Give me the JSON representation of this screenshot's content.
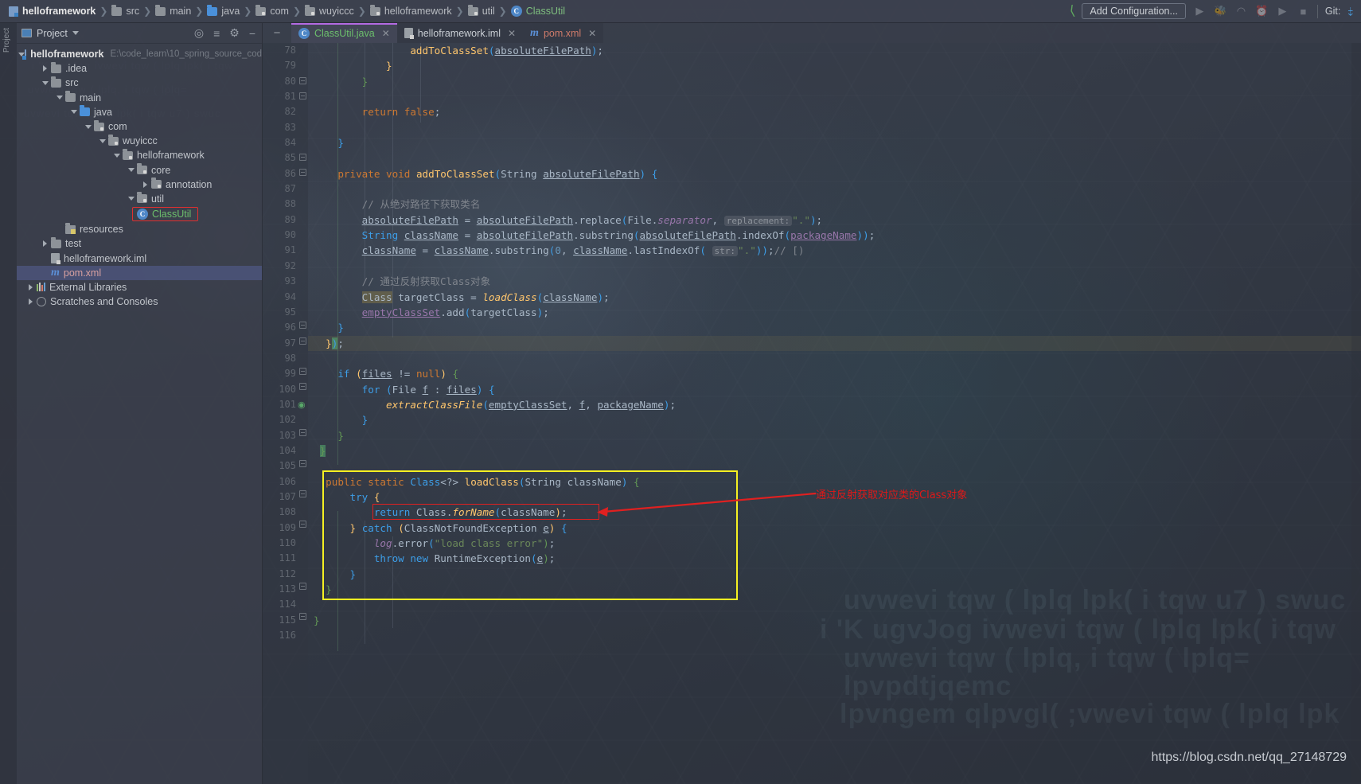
{
  "window": {
    "breadcrumb": [
      {
        "label": "helloframework",
        "icon": "module-icon"
      },
      {
        "label": "src",
        "icon": "folder-icon"
      },
      {
        "label": "main",
        "icon": "folder-icon"
      },
      {
        "label": "java",
        "icon": "source-folder-icon"
      },
      {
        "label": "com",
        "icon": "package-icon"
      },
      {
        "label": "wuyiccc",
        "icon": "package-icon"
      },
      {
        "label": "helloframework",
        "icon": "package-icon"
      },
      {
        "label": "util",
        "icon": "package-icon"
      },
      {
        "label": "ClassUtil",
        "icon": "class-icon"
      }
    ],
    "toolbar": {
      "add_configuration_label": "Add Configuration...",
      "git_label": "Git:",
      "icons": [
        "run-icon",
        "debug-icon",
        "run-with-coverage-icon",
        "profiler-icon",
        "run-alt-icon",
        "stop-icon"
      ]
    }
  },
  "left_rail": {
    "label": "Project"
  },
  "project_panel": {
    "title": "Project",
    "header_icons": [
      "locate-icon",
      "collapse-all-icon",
      "settings-gear-icon",
      "hide-icon"
    ],
    "tree": [
      {
        "depth": 0,
        "label": "helloframework",
        "path": "E:\\code_learn\\10_spring_source_cod",
        "icon": "module-icon",
        "arrow": "open",
        "bold": true
      },
      {
        "depth": 1,
        "label": ".idea",
        "icon": "folder-icon",
        "arrow": "closed"
      },
      {
        "depth": 1,
        "label": "src",
        "icon": "folder-icon",
        "arrow": "open"
      },
      {
        "depth": 2,
        "label": "main",
        "icon": "folder-icon",
        "arrow": "open"
      },
      {
        "depth": 3,
        "label": "java",
        "icon": "source-folder-icon",
        "arrow": "open"
      },
      {
        "depth": 4,
        "label": "com",
        "icon": "package-icon",
        "arrow": "open"
      },
      {
        "depth": 5,
        "label": "wuyiccc",
        "icon": "package-icon",
        "arrow": "open"
      },
      {
        "depth": 6,
        "label": "helloframework",
        "icon": "package-icon",
        "arrow": "open"
      },
      {
        "depth": 7,
        "label": "core",
        "icon": "package-icon",
        "arrow": "open"
      },
      {
        "depth": 8,
        "label": "annotation",
        "icon": "package-icon",
        "arrow": "closed"
      },
      {
        "depth": 8,
        "label": "util",
        "icon": "package-icon",
        "arrow": "open"
      },
      {
        "depth": 9,
        "label": "ClassUtil",
        "icon": "class-icon",
        "arrow": "none",
        "highlighted": true,
        "green": true
      },
      {
        "depth": 3,
        "label": "resources",
        "icon": "resources-folder-icon",
        "arrow": "none"
      },
      {
        "depth": 2,
        "label": "test",
        "icon": "folder-icon",
        "arrow": "closed"
      },
      {
        "depth": 1,
        "label": "helloframework.iml",
        "icon": "iml-file-icon",
        "arrow": "none"
      },
      {
        "depth": 1,
        "label": "pom.xml",
        "icon": "maven-icon",
        "arrow": "none",
        "selected": true
      },
      {
        "depth": 0,
        "label": "External Libraries",
        "icon": "libraries-icon",
        "arrow": "closed"
      },
      {
        "depth": 0,
        "label": "Scratches and Consoles",
        "icon": "scratches-icon",
        "arrow": "closed"
      }
    ]
  },
  "editor": {
    "tabs": [
      {
        "label": "ClassUtil.java",
        "icon": "class-icon",
        "active": true,
        "closable": true
      },
      {
        "label": "helloframework.iml",
        "icon": "iml-file-icon",
        "active": false,
        "closable": true
      },
      {
        "label": "pom.xml",
        "icon": "maven-icon",
        "active": false,
        "closable": true
      }
    ],
    "first_line_number": 78,
    "highlighted_line": 97,
    "lines": [
      {
        "n": 78,
        "text": "                addToClassSet(absoluteFilePath);"
      },
      {
        "n": 79,
        "text": "            }"
      },
      {
        "n": 80,
        "text": "        }"
      },
      {
        "n": 81,
        "text": ""
      },
      {
        "n": 82,
        "text": "        return false;"
      },
      {
        "n": 83,
        "text": ""
      },
      {
        "n": 84,
        "text": "    }"
      },
      {
        "n": 85,
        "text": ""
      },
      {
        "n": 86,
        "text": "    private void addToClassSet(String absoluteFilePath) {"
      },
      {
        "n": 87,
        "text": ""
      },
      {
        "n": 88,
        "text": "        // 从绝对路径下获取类名"
      },
      {
        "n": 89,
        "text": "        absoluteFilePath = absoluteFilePath.replace(File.separator,  replacement: \".\");"
      },
      {
        "n": 90,
        "text": "        String className = absoluteFilePath.substring(absoluteFilePath.indexOf(packageName));"
      },
      {
        "n": 91,
        "text": "        className = className.substring(0, className.lastIndexOf( str: \".\"));// [)"
      },
      {
        "n": 92,
        "text": ""
      },
      {
        "n": 93,
        "text": "        // 通过反射获取Class对象"
      },
      {
        "n": 94,
        "text": "        Class targetClass = loadClass(className);"
      },
      {
        "n": 95,
        "text": "        emptyClassSet.add(targetClass);"
      },
      {
        "n": 96,
        "text": "    }"
      },
      {
        "n": 97,
        "text": "    });"
      },
      {
        "n": 98,
        "text": ""
      },
      {
        "n": 99,
        "text": "    if (files != null) {"
      },
      {
        "n": 100,
        "text": "        for (File f : files) {"
      },
      {
        "n": 101,
        "text": "            extractClassFile(emptyClassSet, f, packageName);"
      },
      {
        "n": 102,
        "text": "        }"
      },
      {
        "n": 103,
        "text": "    }"
      },
      {
        "n": 104,
        "text": "}"
      },
      {
        "n": 105,
        "text": ""
      },
      {
        "n": 106,
        "text": "public static Class<?> loadClass(String className) {"
      },
      {
        "n": 107,
        "text": "    try {"
      },
      {
        "n": 108,
        "text": "        return Class.forName(className);"
      },
      {
        "n": 109,
        "text": "    } catch (ClassNotFoundException e) {"
      },
      {
        "n": 110,
        "text": "        log.error(\"load class error\");"
      },
      {
        "n": 111,
        "text": "        throw new RuntimeException(e);"
      },
      {
        "n": 112,
        "text": "    }"
      },
      {
        "n": 113,
        "text": "}"
      },
      {
        "n": 114,
        "text": ""
      },
      {
        "n": 115,
        "text": "}"
      },
      {
        "n": 116,
        "text": ""
      }
    ]
  },
  "annotations": {
    "callout_text": "通过反射获取对应类的Class对象",
    "callout_color": "#e01818",
    "highlight_box_color": "#f5f022",
    "inner_box_color": "#e02020"
  },
  "watermark": {
    "text": "https://blog.csdn.net/qq_27148729"
  },
  "background_text": [
    "uvwevi tqw ( lplq lpk( i tqw u7 ) swuc",
    "i 'K ugvJog ivwevi tqw ( lplq lpk( i tqw",
    "uvwevi tqw ( lplq, i tqw ( lplq=",
    "lpvpdtjqemc",
    "lpvngem qlpvgl( ;vwevi tqw ( lplq lpk"
  ],
  "colors": {
    "accent_purple": "#b36ae2",
    "string_green": "#6a8759",
    "keyword_orange": "#cc7832",
    "method_yellow": "#ffc66d",
    "field_purple": "#9876aa",
    "comment_gray": "#7f848c"
  }
}
